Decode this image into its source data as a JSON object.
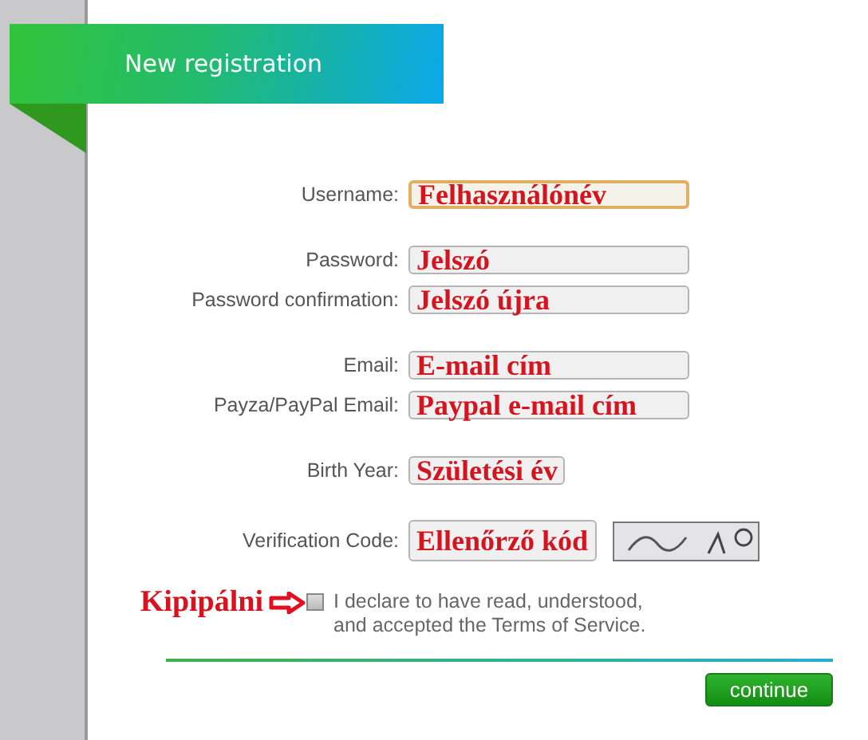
{
  "banner": {
    "title": "New registration"
  },
  "form": {
    "groups": [
      {
        "fields": [
          {
            "label": "Username:",
            "kind": "text",
            "focused": true,
            "annotation": "Felhasználónév"
          }
        ]
      },
      {
        "fields": [
          {
            "label": "Password:",
            "kind": "text",
            "focused": false,
            "annotation": "Jelszó"
          },
          {
            "label": "Password confirmation:",
            "kind": "text",
            "focused": false,
            "annotation": "Jelszó újra"
          }
        ]
      },
      {
        "fields": [
          {
            "label": "Email:",
            "kind": "text",
            "focused": false,
            "annotation": "E-mail cím"
          },
          {
            "label": "Payza/PayPal Email:",
            "kind": "text",
            "focused": false,
            "annotation": "Paypal e-mail cím"
          }
        ]
      },
      {
        "fields": [
          {
            "label": "Birth Year:",
            "kind": "year",
            "focused": false,
            "annotation": "Születési év"
          }
        ]
      },
      {
        "fields": [
          {
            "label": "Verification Code:",
            "kind": "captcha",
            "focused": false,
            "annotation": "Ellenőrző kód"
          }
        ]
      }
    ]
  },
  "terms": {
    "annotation": "Kipipálni",
    "checked": false,
    "lines": [
      "I declare to have read, understood,",
      "and accepted the Terms of Service."
    ]
  },
  "button": "continue"
}
